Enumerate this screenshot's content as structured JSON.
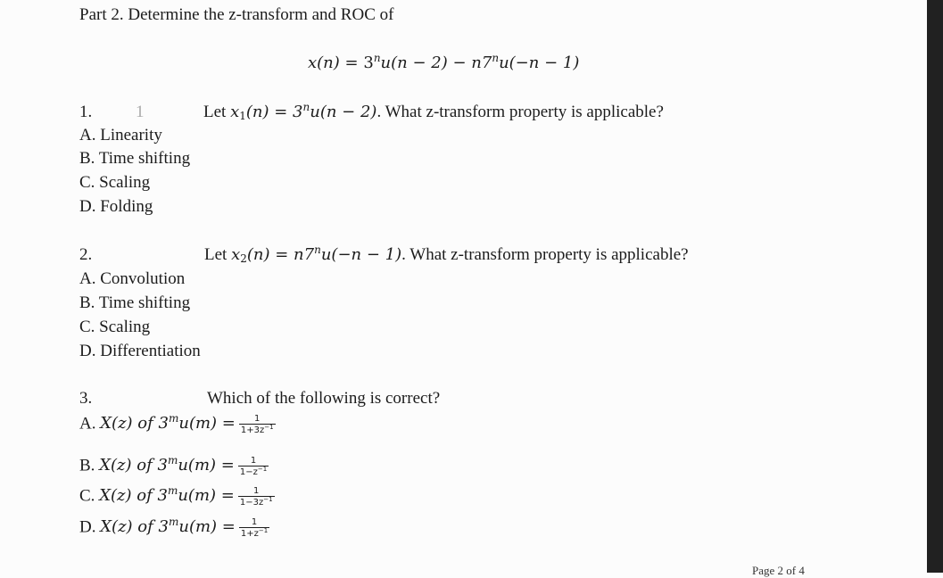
{
  "document": {
    "heading": "Part 2. Determine the z-transform and ROC of",
    "main_equation": {
      "lhs": "x(n)",
      "eq": "=",
      "rhs_part1_base": "3",
      "rhs_part1_exp": "n",
      "rhs_part1_rest": "u(n − 2) − n7",
      "rhs_part2_exp": "n",
      "rhs_part2_rest": "u(−n − 1)"
    },
    "questions": [
      {
        "number": "1.",
        "faint_mark": "1",
        "prompt_prefix": "Let ",
        "signal_name": "x",
        "signal_sub": "1",
        "signal_arg": "(n) = 3",
        "signal_exp": "n",
        "signal_rest": "u(n − 2)",
        "prompt_suffix": ". What z-transform property is applicable?",
        "options": [
          "A. Linearity",
          "B. Time shifting",
          "C. Scaling",
          "D. Folding"
        ]
      },
      {
        "number": "2.",
        "prompt_prefix": "Let ",
        "signal_name": "x",
        "signal_sub": "2",
        "signal_arg": "(n) = n7",
        "signal_exp": "n",
        "signal_rest": "u(−n − 1)",
        "prompt_suffix": ". What z-transform property is applicable?",
        "options": [
          "A. Convolution",
          "B. Time shifting",
          "C. Scaling",
          "D. Differentiation"
        ]
      },
      {
        "number": "3.",
        "prompt": "Which of the following is correct?",
        "options": [
          {
            "letter": "A.",
            "expr": "X(z) of 3",
            "exp": "m",
            "expr_rest": "u(m) =",
            "numerator": "1",
            "denominator": "1+3z",
            "den_exp": "−1"
          },
          {
            "letter": "B.",
            "expr": "X(z) of 3",
            "exp": "m",
            "expr_rest": "u(m) =",
            "numerator": "1",
            "denominator": "1−z",
            "den_exp": "−1"
          },
          {
            "letter": "C.",
            "expr": "X(z) of 3",
            "exp": "m",
            "expr_rest": "u(m) =",
            "numerator": "1",
            "denominator": "1−3z",
            "den_exp": "−1"
          },
          {
            "letter": "D.",
            "expr": "X(z) of 3",
            "exp": "m",
            "expr_rest": "u(m) =",
            "numerator": "1",
            "denominator": "1+z",
            "den_exp": "−1"
          }
        ]
      }
    ],
    "footer": "Page 2 of 4"
  }
}
